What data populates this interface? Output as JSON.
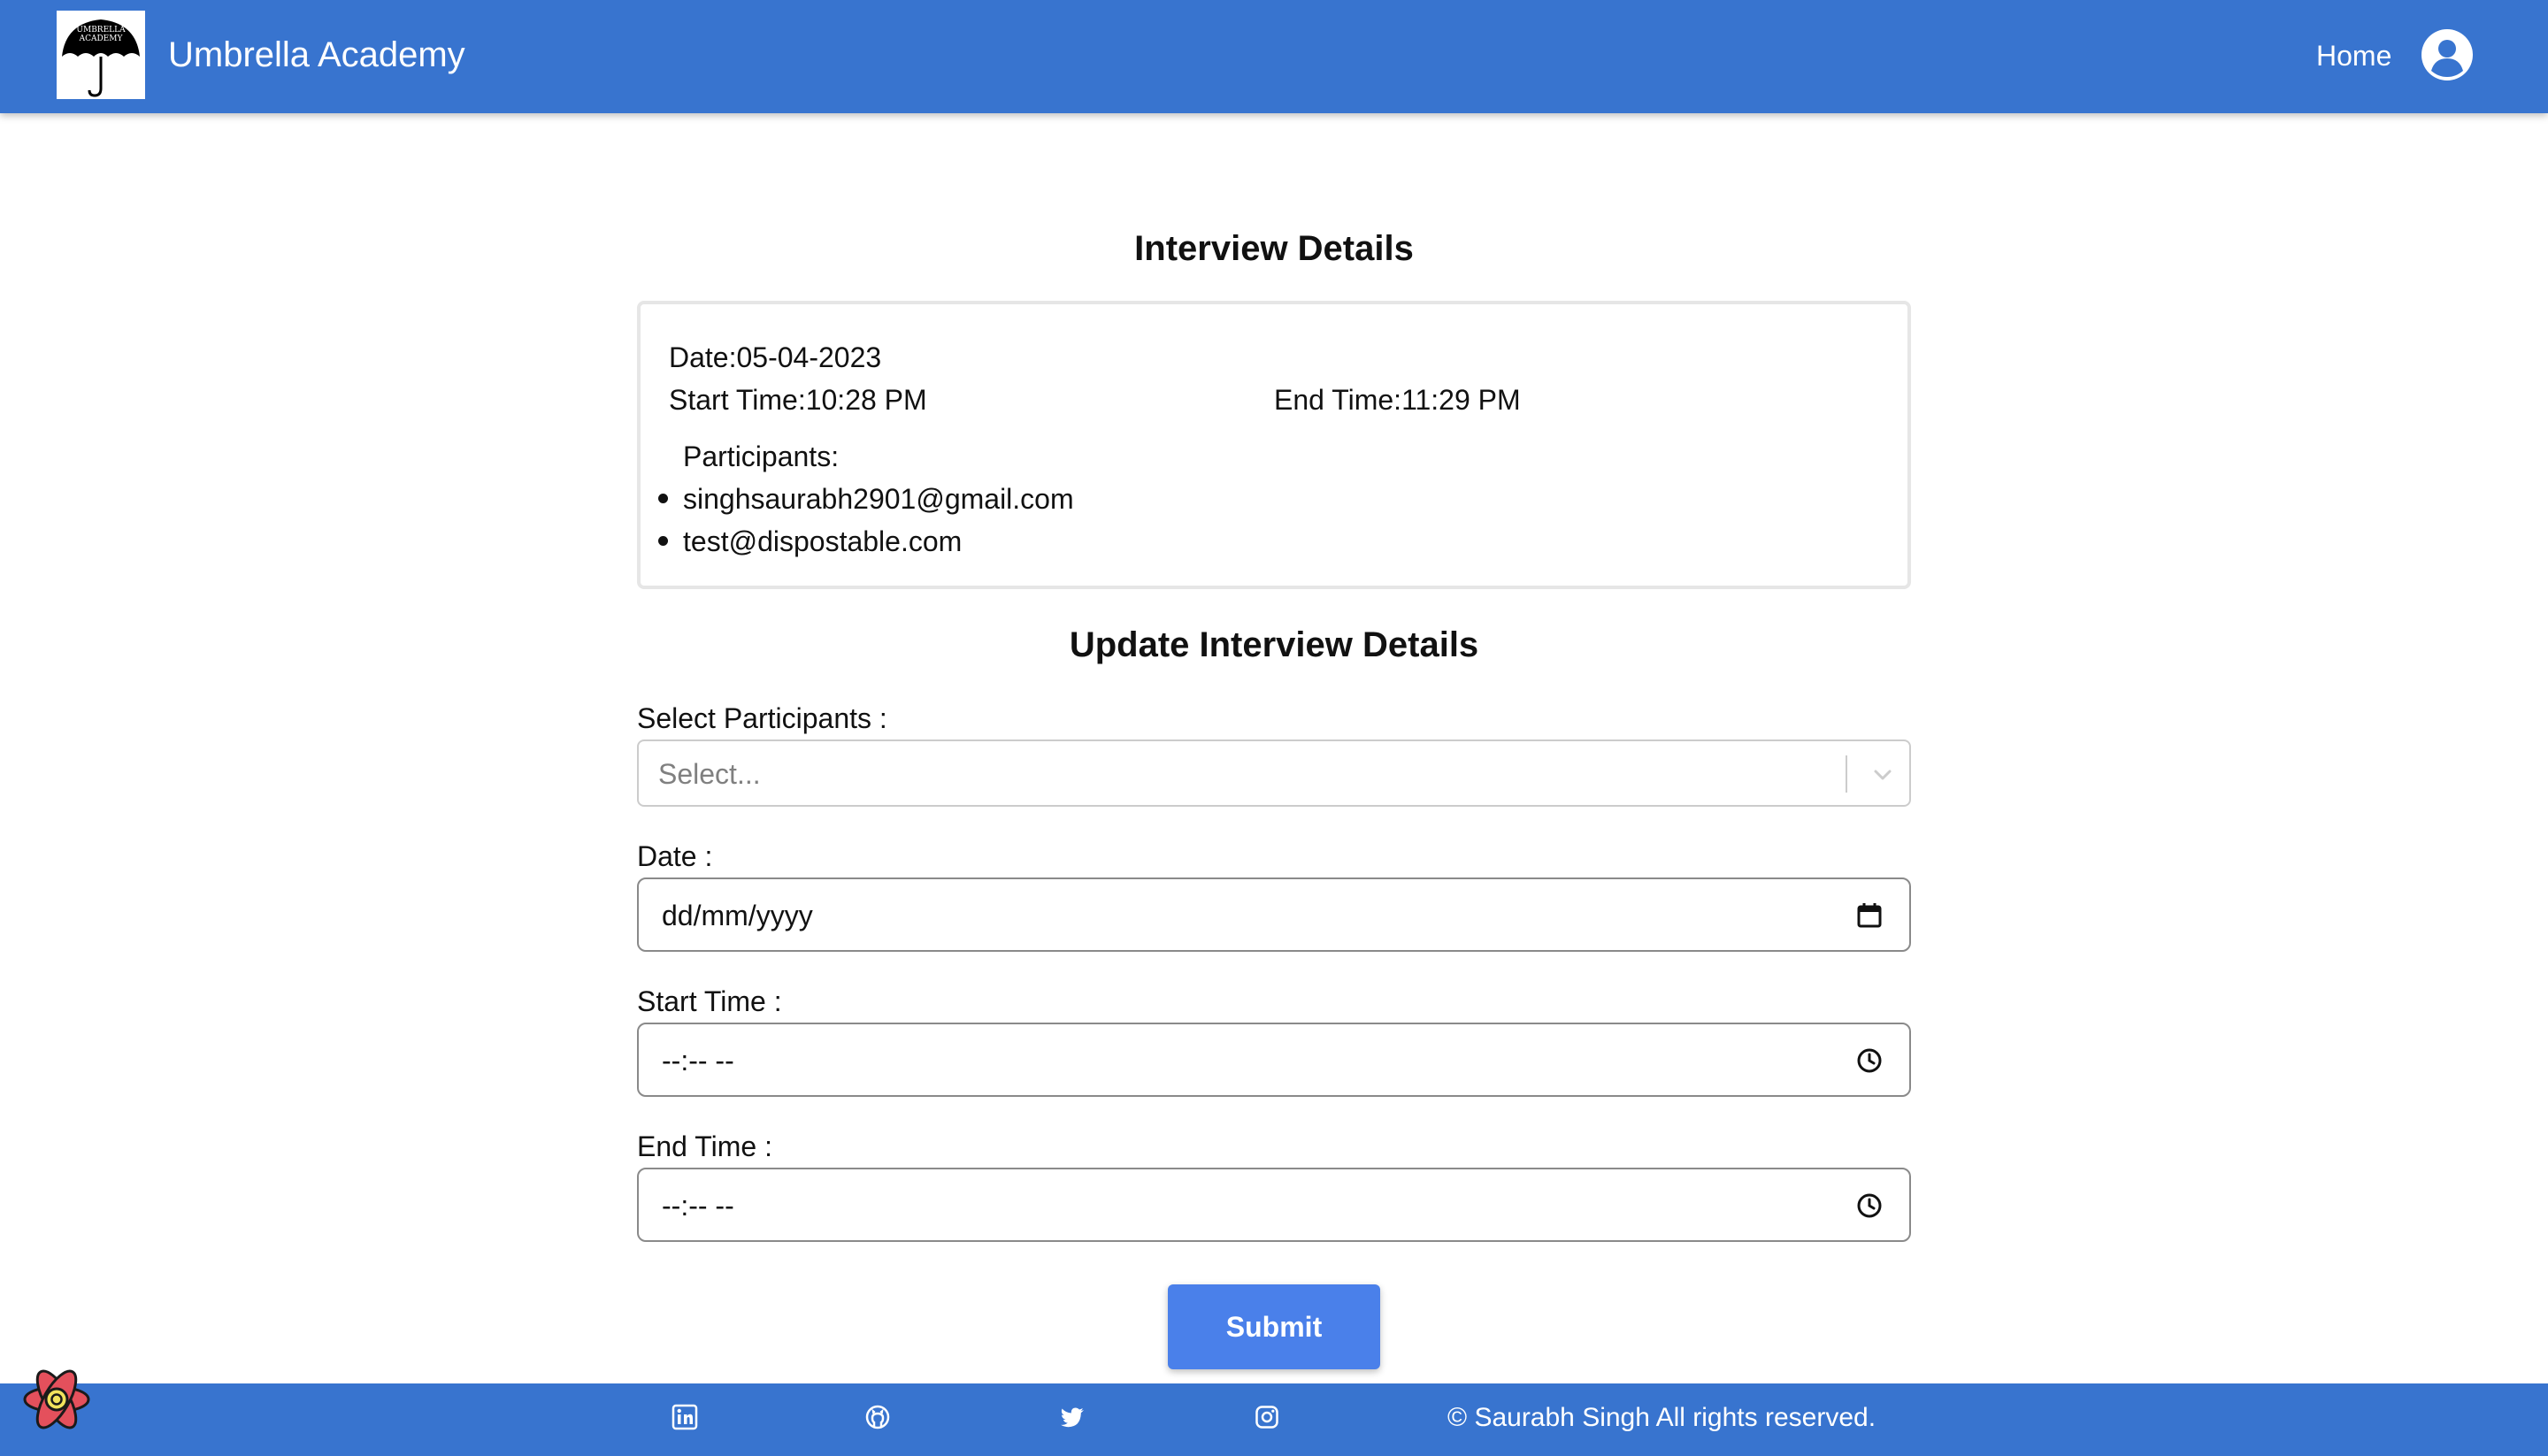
{
  "header": {
    "brand": "Umbrella Academy",
    "logo_text_top": "UMBRELLA",
    "logo_text_bottom": "ACADEMY",
    "nav_home": "Home",
    "avatar_icon": "user-circle-icon",
    "bg_color": "#3874cf"
  },
  "details": {
    "title": "Interview Details",
    "date_label": "Date:",
    "date_value": "05-04-2023",
    "start_label": "Start Time:",
    "start_value": "10:28 PM",
    "end_label": "End Time:",
    "end_value": "11:29 PM",
    "participants_label": "Participants:",
    "participants": [
      "singhsaurabh2901@gmail.com",
      "test@dispostable.com"
    ]
  },
  "form": {
    "title": "Update Interview Details",
    "participants_label": "Select Participants :",
    "participants_placeholder": "Select...",
    "date_label": "Date :",
    "date_placeholder": "dd/mm/yyyy",
    "start_label": "Start Time :",
    "start_placeholder": "--:-- --",
    "end_label": "End Time :",
    "end_placeholder": "--:-- --",
    "submit_label": "Submit",
    "submit_color": "#4a80ea"
  },
  "footer": {
    "icons": [
      "linkedin-icon",
      "github-icon",
      "twitter-icon",
      "instagram-icon"
    ],
    "copyright": "© Saurabh Singh All rights reserved."
  }
}
